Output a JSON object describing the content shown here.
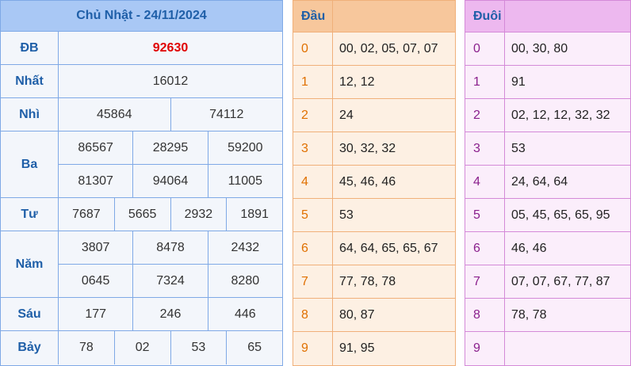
{
  "results": {
    "title": "Chủ Nhật - 24/11/2024",
    "prizes": [
      {
        "label": "ĐB",
        "lines": [
          [
            "92630"
          ]
        ],
        "special": true
      },
      {
        "label": "Nhất",
        "lines": [
          [
            "16012"
          ]
        ]
      },
      {
        "label": "Nhì",
        "lines": [
          [
            "45864",
            "74112"
          ]
        ]
      },
      {
        "label": "Ba",
        "lines": [
          [
            "86567",
            "28295",
            "59200"
          ],
          [
            "81307",
            "94064",
            "11005"
          ]
        ]
      },
      {
        "label": "Tư",
        "lines": [
          [
            "7687",
            "5665",
            "2932",
            "1891"
          ]
        ]
      },
      {
        "label": "Năm",
        "lines": [
          [
            "3807",
            "8478",
            "2432"
          ],
          [
            "0645",
            "7324",
            "8280"
          ]
        ]
      },
      {
        "label": "Sáu",
        "lines": [
          [
            "177",
            "246",
            "446"
          ]
        ]
      },
      {
        "label": "Bảy",
        "lines": [
          [
            "78",
            "02",
            "53",
            "65"
          ]
        ]
      }
    ]
  },
  "dau": {
    "header": "Đầu",
    "rows": [
      {
        "k": "0",
        "v": "00, 02, 05, 07, 07"
      },
      {
        "k": "1",
        "v": "12, 12"
      },
      {
        "k": "2",
        "v": "24"
      },
      {
        "k": "3",
        "v": "30, 32, 32"
      },
      {
        "k": "4",
        "v": "45, 46, 46"
      },
      {
        "k": "5",
        "v": "53"
      },
      {
        "k": "6",
        "v": "64, 64, 65, 65, 67"
      },
      {
        "k": "7",
        "v": "77, 78, 78"
      },
      {
        "k": "8",
        "v": "80, 87"
      },
      {
        "k": "9",
        "v": "91, 95"
      }
    ]
  },
  "duoi": {
    "header": "Đuôi",
    "rows": [
      {
        "k": "0",
        "v": "00, 30, 80"
      },
      {
        "k": "1",
        "v": "91"
      },
      {
        "k": "2",
        "v": "02, 12, 12, 32, 32"
      },
      {
        "k": "3",
        "v": "53"
      },
      {
        "k": "4",
        "v": "24, 64, 64"
      },
      {
        "k": "5",
        "v": "05, 45, 65, 65, 95"
      },
      {
        "k": "6",
        "v": "46, 46"
      },
      {
        "k": "7",
        "v": "07, 07, 67, 77, 87"
      },
      {
        "k": "8",
        "v": "78, 78"
      },
      {
        "k": "9",
        "v": ""
      }
    ]
  },
  "colors": {
    "special": "#e00000",
    "results_header": "#a9c8f5",
    "dau_header": "#f7c79c",
    "duoi_header": "#edb8ef"
  }
}
